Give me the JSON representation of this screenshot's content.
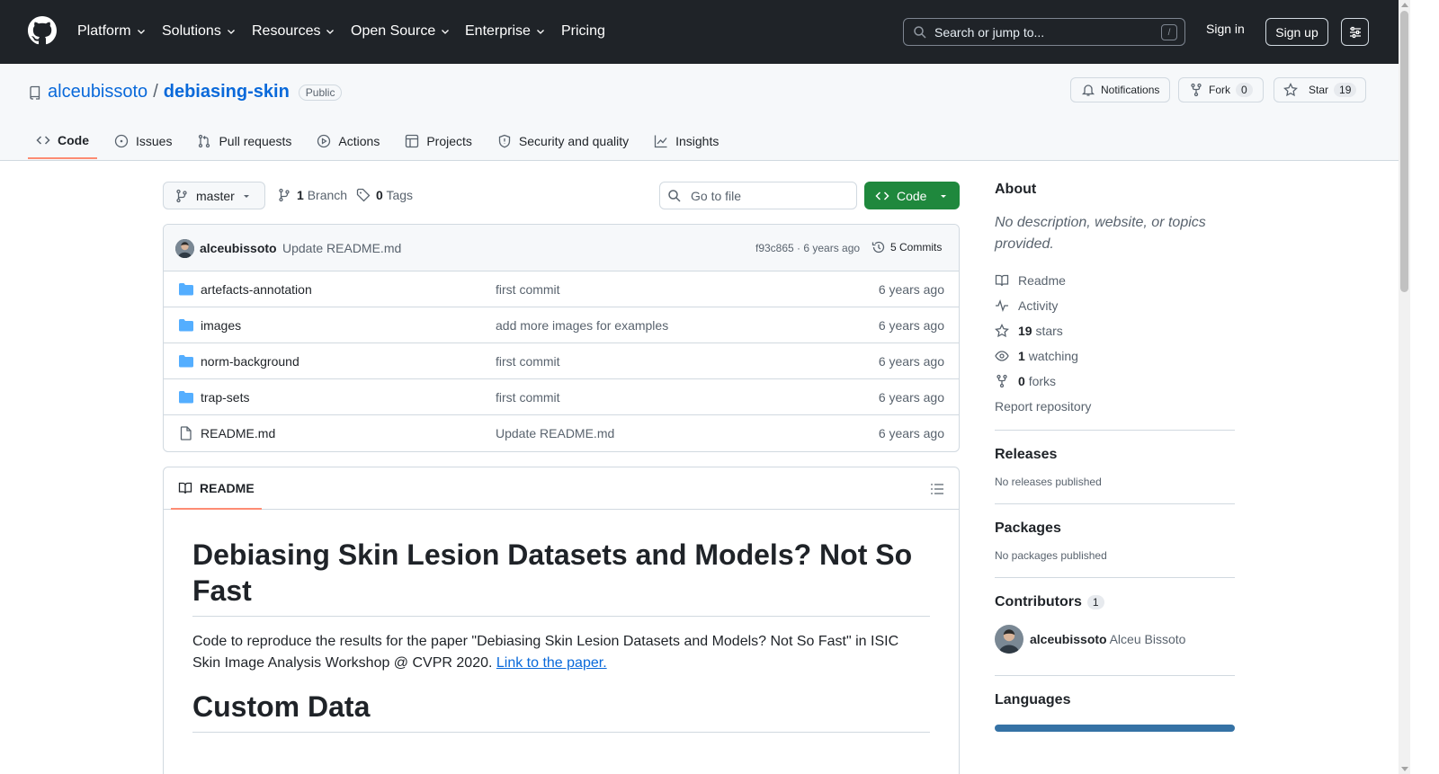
{
  "header": {
    "nav": [
      {
        "label": "Platform",
        "dropdown": true
      },
      {
        "label": "Solutions",
        "dropdown": true
      },
      {
        "label": "Resources",
        "dropdown": true
      },
      {
        "label": "Open Source",
        "dropdown": true
      },
      {
        "label": "Enterprise",
        "dropdown": true
      },
      {
        "label": "Pricing",
        "dropdown": false
      }
    ],
    "search_placeholder": "Search or jump to...",
    "search_shortcut": "/",
    "signin": "Sign in",
    "signup": "Sign up"
  },
  "repo": {
    "owner": "alceubissoto",
    "separator": "/",
    "name": "debiasing-skin",
    "visibility": "Public",
    "notifications_label": "Notifications",
    "fork_label": "Fork",
    "fork_count": "0",
    "star_label": "Star",
    "star_count": "19"
  },
  "tabs": [
    {
      "label": "Code",
      "icon": "code-icon",
      "active": true
    },
    {
      "label": "Issues",
      "icon": "issue-icon",
      "active": false
    },
    {
      "label": "Pull requests",
      "icon": "pull-request-icon",
      "active": false
    },
    {
      "label": "Actions",
      "icon": "play-icon",
      "active": false
    },
    {
      "label": "Projects",
      "icon": "table-icon",
      "active": false
    },
    {
      "label": "Security and quality",
      "icon": "shield-icon",
      "active": false
    },
    {
      "label": "Insights",
      "icon": "graph-icon",
      "active": false
    }
  ],
  "toolbar": {
    "branch": "master",
    "branch_count": "1",
    "branch_label": "Branch",
    "tag_count": "0",
    "tag_label": "Tags",
    "goto_placeholder": "Go to file",
    "code_button": "Code"
  },
  "latest_commit": {
    "author": "alceubissoto",
    "message": "Update README.md",
    "hash_time": "f93c865 · 6 years ago",
    "commits_label": "5 Commits"
  },
  "files": [
    {
      "name": "artefacts-annotation",
      "type": "folder",
      "commit": "first commit",
      "age": "6 years ago"
    },
    {
      "name": "images",
      "type": "folder",
      "commit": "add more images for examples",
      "age": "6 years ago"
    },
    {
      "name": "norm-background",
      "type": "folder",
      "commit": "first commit",
      "age": "6 years ago"
    },
    {
      "name": "trap-sets",
      "type": "folder",
      "commit": "first commit",
      "age": "6 years ago"
    },
    {
      "name": "README.md",
      "type": "file",
      "commit": "Update README.md",
      "age": "6 years ago"
    }
  ],
  "readme": {
    "tab_label": "README",
    "title": "Debiasing Skin Lesion Datasets and Models? Not So Fast",
    "paragraph": "Code to reproduce the results for the paper \"Debiasing Skin Lesion Datasets and Models? Not So Fast\" in ISIC Skin Image Analysis Workshop @ CVPR 2020. ",
    "link_text": "Link to the paper.",
    "h2": "Custom Data"
  },
  "sidebar": {
    "about_title": "About",
    "about_desc": "No description, website, or topics provided.",
    "readme": "Readme",
    "activity": "Activity",
    "stars_count": "19",
    "stars_label": "stars",
    "watching_count": "1",
    "watching_label": "watching",
    "forks_count": "0",
    "forks_label": "forks",
    "report": "Report repository",
    "releases_title": "Releases",
    "releases_text": "No releases published",
    "packages_title": "Packages",
    "packages_text": "No packages published",
    "contributors_title": "Contributors",
    "contributors_count": "1",
    "contributor_login": "alceubissoto",
    "contributor_name": "Alceu Bissoto",
    "languages_title": "Languages"
  },
  "colors": {
    "header_bg": "#1f2328",
    "link": "#0969da",
    "primary_button": "#1f883d",
    "active_tab_underline": "#fd8c73",
    "language_bar": "#3572a5"
  }
}
